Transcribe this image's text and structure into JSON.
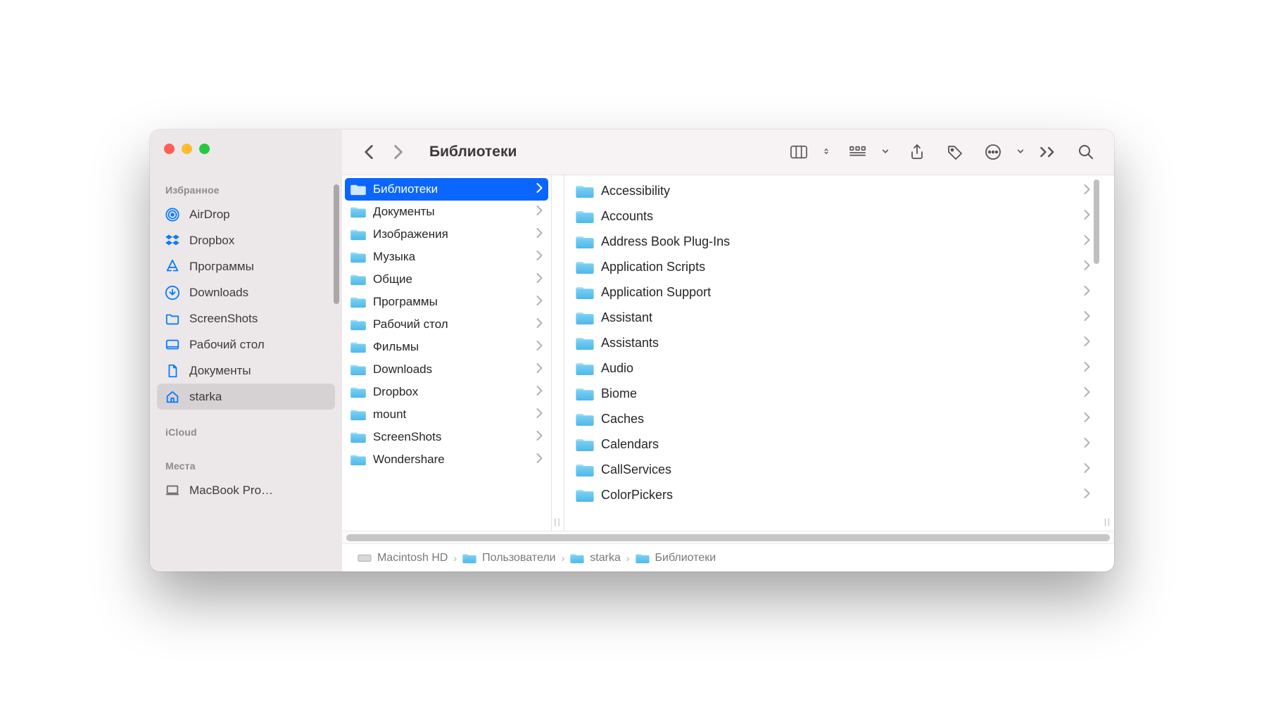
{
  "window": {
    "title": "Библиотеки"
  },
  "traffic": {
    "close": "close",
    "minimize": "minimize",
    "zoom": "zoom"
  },
  "sidebar": {
    "sections": [
      {
        "label": "Избранное",
        "items": [
          {
            "icon": "airdrop",
            "label": "AirDrop",
            "selected": false
          },
          {
            "icon": "dropbox",
            "label": "Dropbox",
            "selected": false
          },
          {
            "icon": "apps",
            "label": "Программы",
            "selected": false
          },
          {
            "icon": "download",
            "label": "Downloads",
            "selected": false
          },
          {
            "icon": "folder",
            "label": "ScreenShots",
            "selected": false
          },
          {
            "icon": "desktop",
            "label": "Рабочий стол",
            "selected": false
          },
          {
            "icon": "document",
            "label": "Документы",
            "selected": false
          },
          {
            "icon": "home",
            "label": "starka",
            "selected": true
          }
        ]
      },
      {
        "label": "iCloud",
        "items": []
      },
      {
        "label": "Места",
        "items": [
          {
            "icon": "laptop",
            "label": "MacBook Pro…",
            "selected": false
          }
        ]
      }
    ]
  },
  "toolbar": {
    "back": "Назад",
    "forward": "Вперёд",
    "view": "column-view",
    "group": "group-by",
    "share": "share",
    "tags": "tags",
    "more": "more",
    "overflow": "overflow",
    "search": "search"
  },
  "column1": {
    "items": [
      {
        "label": "Библиотеки",
        "selected": true
      },
      {
        "label": "Документы",
        "selected": false
      },
      {
        "label": "Изображения",
        "selected": false
      },
      {
        "label": "Музыка",
        "selected": false
      },
      {
        "label": "Общие",
        "selected": false
      },
      {
        "label": "Программы",
        "selected": false
      },
      {
        "label": "Рабочий стол",
        "selected": false
      },
      {
        "label": "Фильмы",
        "selected": false
      },
      {
        "label": "Downloads",
        "selected": false
      },
      {
        "label": "Dropbox",
        "selected": false
      },
      {
        "label": "mount",
        "selected": false
      },
      {
        "label": "ScreenShots",
        "selected": false
      },
      {
        "label": "Wondershare",
        "selected": false
      }
    ]
  },
  "column2": {
    "items": [
      {
        "label": "Accessibility"
      },
      {
        "label": "Accounts"
      },
      {
        "label": "Address Book Plug-Ins"
      },
      {
        "label": "Application Scripts"
      },
      {
        "label": "Application Support"
      },
      {
        "label": "Assistant"
      },
      {
        "label": "Assistants"
      },
      {
        "label": "Audio"
      },
      {
        "label": "Biome"
      },
      {
        "label": "Caches"
      },
      {
        "label": "Calendars"
      },
      {
        "label": "CallServices"
      },
      {
        "label": "ColorPickers"
      }
    ]
  },
  "pathbar": {
    "items": [
      {
        "icon": "disk",
        "label": "Macintosh HD"
      },
      {
        "icon": "folder",
        "label": "Пользователи"
      },
      {
        "icon": "folder",
        "label": "starka"
      },
      {
        "icon": "folder",
        "label": "Библиотеки"
      }
    ]
  }
}
